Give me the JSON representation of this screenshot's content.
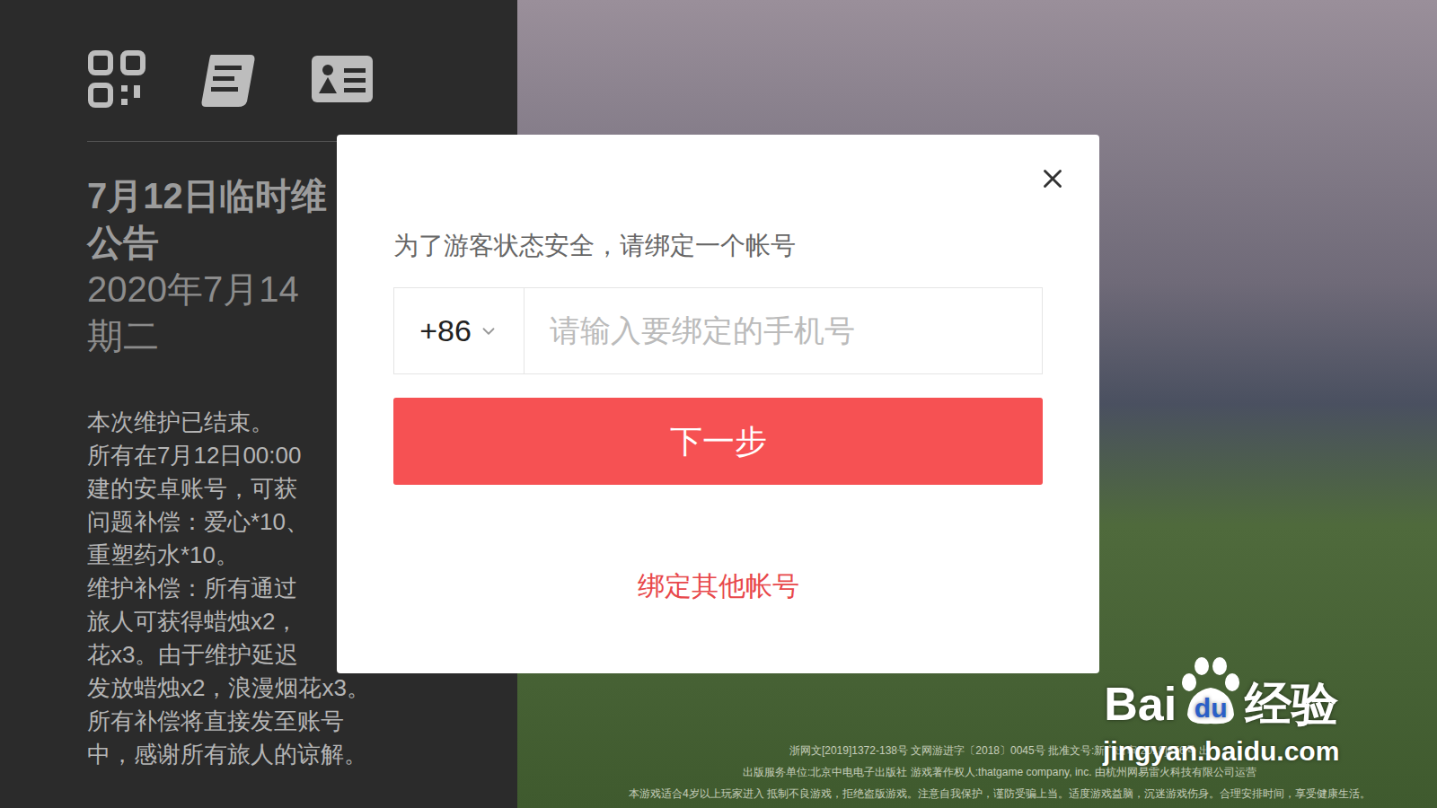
{
  "announcement": {
    "title_lines": [
      "7月12日临时维",
      "公告"
    ],
    "date_lines": [
      "2020年7月14",
      "期二"
    ],
    "body_lines": [
      "本次维护已结束。",
      "所有在7月12日00:00",
      "建的安卓账号，可获",
      "问题补偿：爱心*10、",
      "重塑药水*10。",
      "维护补偿：所有通过",
      "旅人可获得蜡烛x2，",
      "花x3。由于维护延迟",
      "发放蜡烛x2，浪漫烟花x3。",
      "所有补偿将直接发至账号",
      "中，感谢所有旅人的谅解。"
    ]
  },
  "dialog": {
    "prompt": "为了游客状态安全，请绑定一个帐号",
    "country_code": "+86",
    "phone_placeholder": "请输入要绑定的手机号",
    "next_button": "下一步",
    "other_account_link": "绑定其他帐号"
  },
  "legal_lines": [
    "浙网文[2019]1372-138号 文网游进字〔2018〕0045号 批准文号:新广出审[2018]856号 出",
    "出版服务单位:北京中电电子出版社 游戏著作权人:thatgame company, inc. 由杭州网易雷火科技有限公司运营",
    "本游戏适合4岁以上玩家进入 抵制不良游戏，拒绝盗版游戏。注意自我保护，谨防受骗上当。适度游戏益脑，沉迷游戏伤身。合理安排时间，享受健康生活。"
  ],
  "watermark": {
    "brand_left": "Bai",
    "brand_paw": "du",
    "brand_right": "经验",
    "url": "jingyan.baidu.com"
  }
}
